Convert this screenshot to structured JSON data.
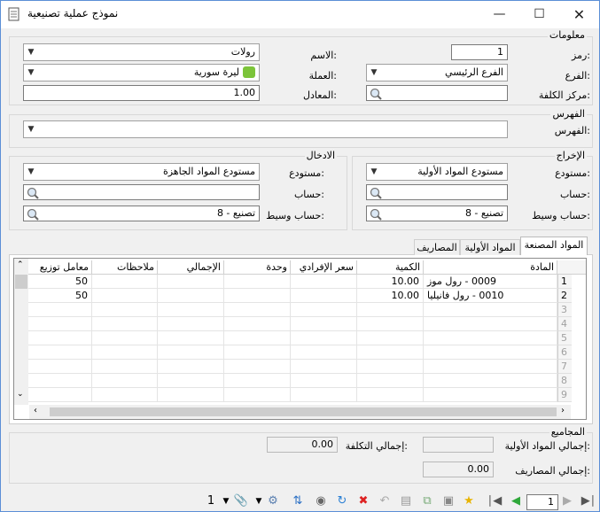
{
  "window": {
    "title": "نموذج عملية تصنيعية"
  },
  "info": {
    "group_label": "معلومات",
    "code_label": "رمز:",
    "code_value": "1",
    "name_label": "الاسم:",
    "name_value": "رولات",
    "branch_label": "الفرع:",
    "branch_value": "الفرع الرئيسي",
    "currency_label": "العملة:",
    "currency_value": "ليرة سورية",
    "cost_center_label": "مركز الكلفة:",
    "cost_center_value": "",
    "rate_label": "المعادل:",
    "rate_value": "1.00"
  },
  "index": {
    "group_label": "الفهرس",
    "label": "الفهرس:",
    "value": ""
  },
  "output": {
    "group_label": "الإخراج",
    "warehouse_label": "مستودع:",
    "warehouse_value": "مستودع المواد الأولية",
    "account_label": "حساب:",
    "account_value": "",
    "mid_account_label": "حساب وسيط:",
    "mid_account_value": "8 - تصنيع"
  },
  "input": {
    "group_label": "الادخال",
    "warehouse_label": "مستودع:",
    "warehouse_value": "مستودع المواد الجاهزة",
    "account_label": "حساب:",
    "account_value": "",
    "mid_account_label": "حساب وسيط:",
    "mid_account_value": "8 - تصنيع"
  },
  "tabs": [
    {
      "label": "المواد المصنعة"
    },
    {
      "label": "المواد الأولية"
    },
    {
      "label": "المصاريف"
    }
  ],
  "grid": {
    "columns": [
      "المادة",
      "الكمية",
      "سعر الإفرادي",
      "وحدة",
      "الإجمالي",
      "ملاحظات",
      "معامل توزيع"
    ],
    "rows": [
      {
        "num": "1",
        "item": "0009 - رول موز",
        "qty": "10.00",
        "factor": "50"
      },
      {
        "num": "2",
        "item": "0010 - رول فانيليا",
        "qty": "10.00",
        "factor": "50"
      },
      {
        "num": "3"
      },
      {
        "num": "4"
      },
      {
        "num": "5"
      },
      {
        "num": "6"
      },
      {
        "num": "7"
      },
      {
        "num": "8"
      },
      {
        "num": "9"
      }
    ]
  },
  "totals": {
    "group_label": "المجاميع",
    "raw_label": "إجمالي المواد الأولية:",
    "raw_value": "",
    "expenses_label": "إجمالي المصاريف:",
    "expenses_value": "0.00",
    "cost_label": "إجمالي التكلفة:",
    "cost_value": "0.00"
  },
  "toolbar": {
    "page_value": "1",
    "attach_count": "1"
  },
  "colors": {
    "title_border": "#5b8fd6",
    "grid_border": "#8c8c8c"
  }
}
